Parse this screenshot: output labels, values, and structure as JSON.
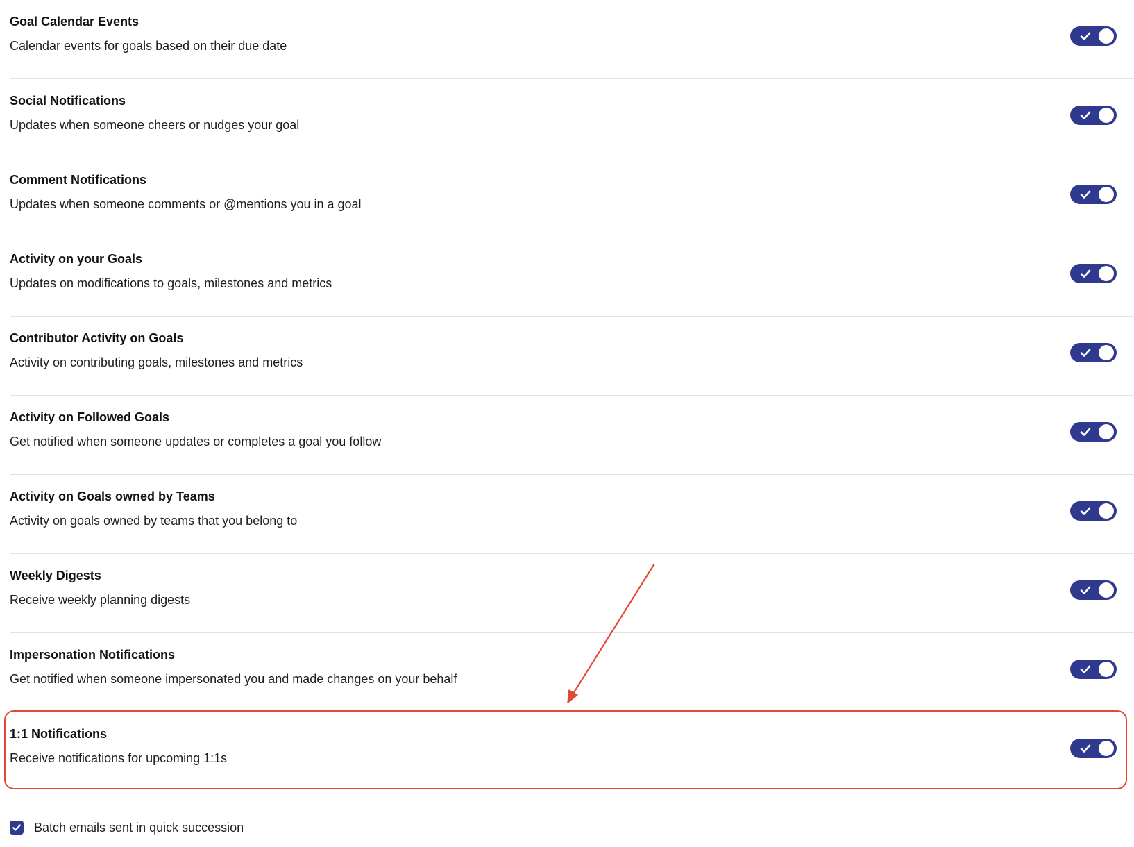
{
  "settings": [
    {
      "title": "Goal Calendar Events",
      "description": "Calendar events for goals based on their due date",
      "enabled": true
    },
    {
      "title": "Social Notifications",
      "description": "Updates when someone cheers or nudges your goal",
      "enabled": true
    },
    {
      "title": "Comment Notifications",
      "description": "Updates when someone comments or @mentions you in a goal",
      "enabled": true
    },
    {
      "title": "Activity on your Goals",
      "description": "Updates on modifications to goals, milestones and metrics",
      "enabled": true
    },
    {
      "title": "Contributor Activity on Goals",
      "description": "Activity on contributing goals, milestones and metrics",
      "enabled": true
    },
    {
      "title": "Activity on Followed Goals",
      "description": "Get notified when someone updates or completes a goal you follow",
      "enabled": true
    },
    {
      "title": "Activity on Goals owned by Teams",
      "description": "Activity on goals owned by teams that you belong to",
      "enabled": true
    },
    {
      "title": "Weekly Digests",
      "description": "Receive weekly planning digests",
      "enabled": true
    },
    {
      "title": "Impersonation Notifications",
      "description": "Get notified when someone impersonated you and made changes on your behalf",
      "enabled": true
    },
    {
      "title": "1:1 Notifications",
      "description": "Receive notifications for upcoming 1:1s",
      "enabled": true
    }
  ],
  "batch_emails": {
    "label": "Batch emails sent in quick succession",
    "checked": true
  },
  "colors": {
    "toggle_on": "#2f3a8f",
    "annotation": "#e04a35",
    "divider": "#e1e1e1"
  },
  "icons": {
    "toggle_check": "check-icon",
    "checkbox_check": "check-icon",
    "annotation": "arrow-icon"
  }
}
